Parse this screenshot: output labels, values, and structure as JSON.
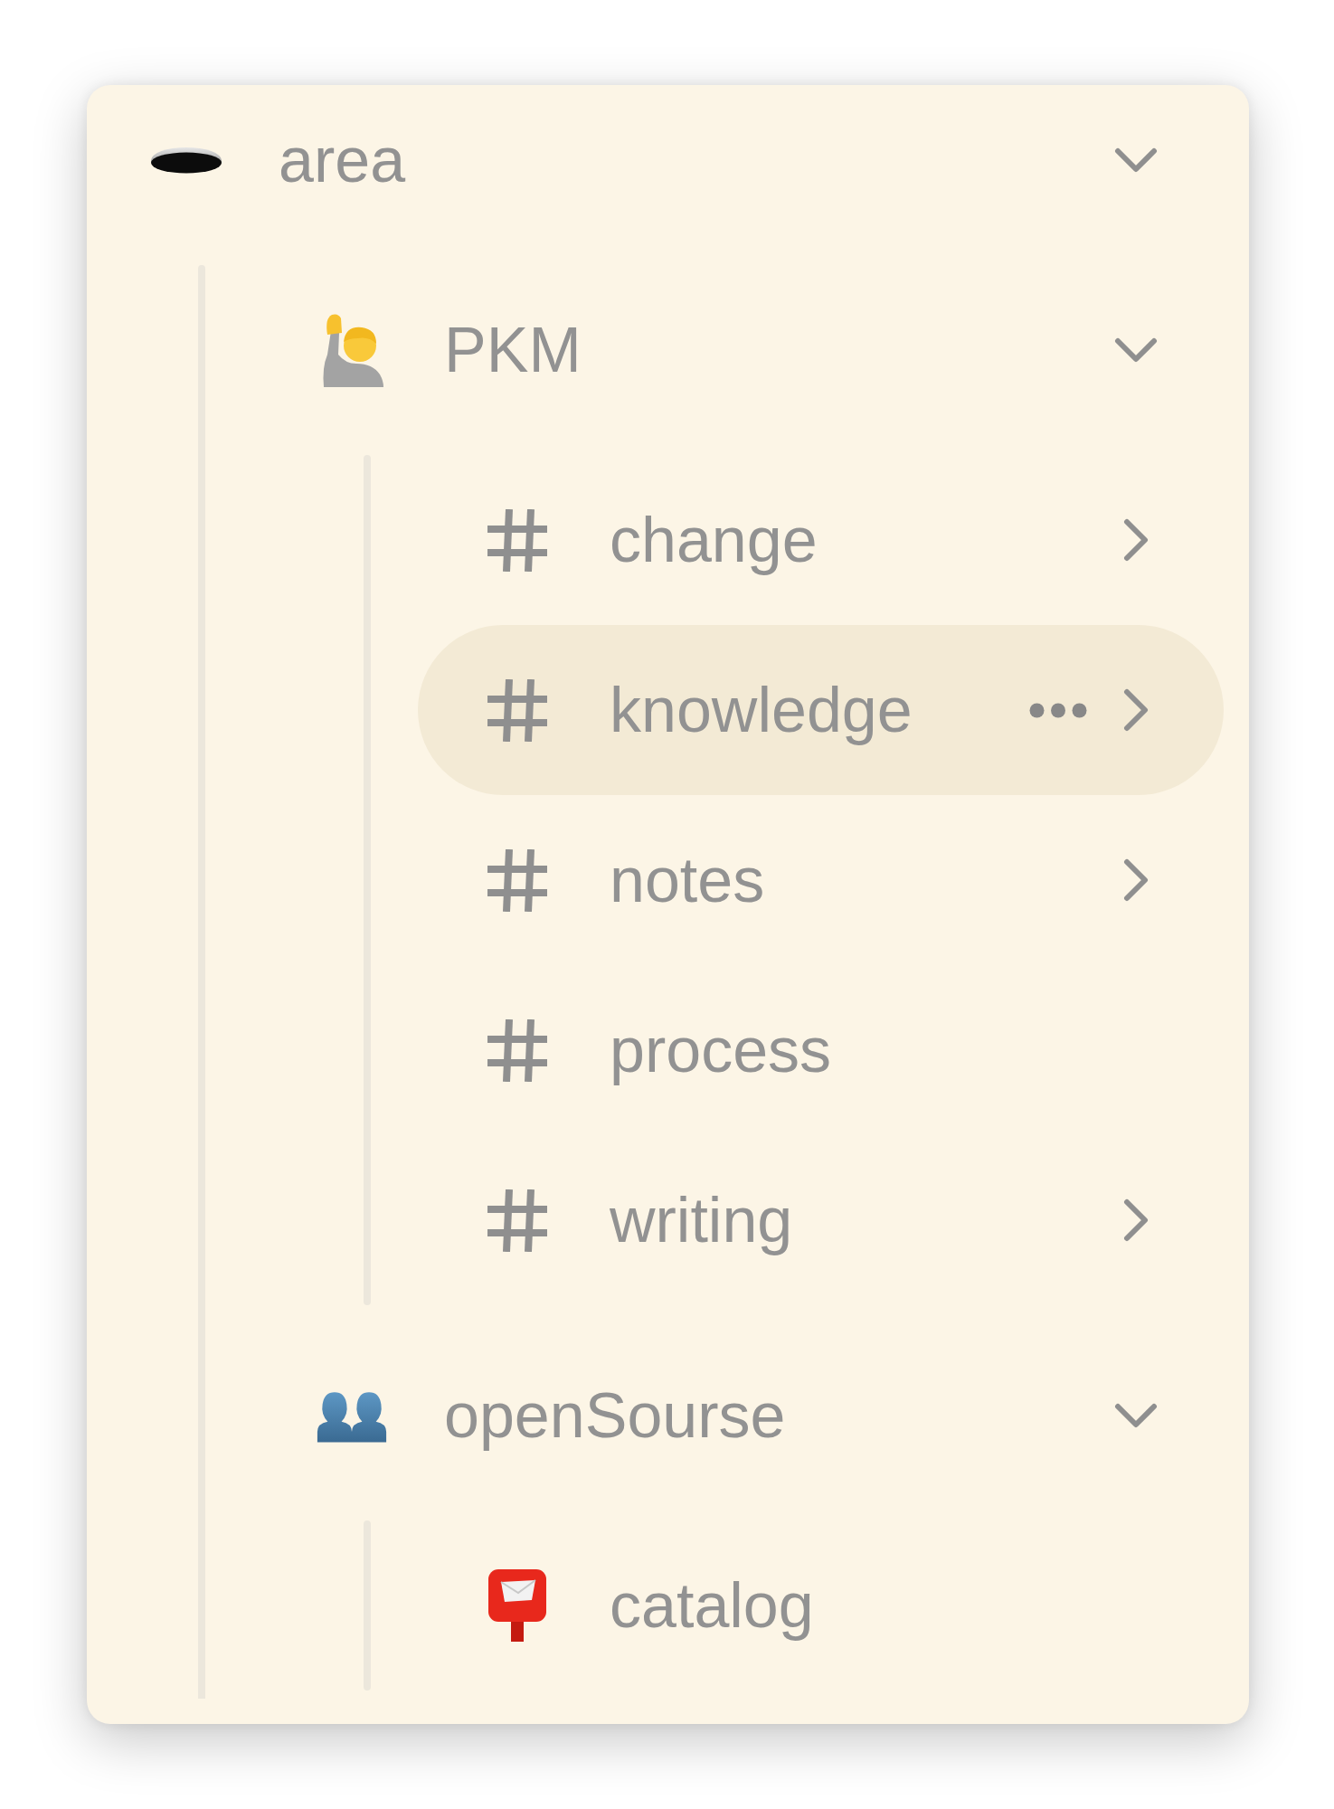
{
  "tree": [
    {
      "label": "area",
      "icon": {
        "kind": "hole"
      },
      "kind": "branch",
      "expanded": true,
      "selected": false,
      "children": [
        {
          "label": "PKM",
          "icon": {
            "kind": "raised-hand"
          },
          "kind": "branch",
          "expanded": true,
          "selected": false,
          "children": [
            {
              "label": "change",
              "icon": {
                "kind": "hash"
              },
              "kind": "branch",
              "expanded": false,
              "selected": false
            },
            {
              "label": "knowledge",
              "icon": {
                "kind": "hash"
              },
              "kind": "branch",
              "expanded": false,
              "selected": true
            },
            {
              "label": "notes",
              "icon": {
                "kind": "hash"
              },
              "kind": "branch",
              "expanded": false,
              "selected": false
            },
            {
              "label": "process",
              "icon": {
                "kind": "hash"
              },
              "kind": "leaf",
              "selected": false
            },
            {
              "label": "writing",
              "icon": {
                "kind": "hash"
              },
              "kind": "branch",
              "expanded": false,
              "selected": false
            }
          ]
        },
        {
          "label": "openSourse",
          "icon": {
            "kind": "people"
          },
          "kind": "branch",
          "expanded": true,
          "selected": false,
          "children": [
            {
              "label": "catalog",
              "icon": {
                "kind": "postbox"
              },
              "kind": "leaf",
              "selected": false
            }
          ]
        }
      ]
    }
  ]
}
